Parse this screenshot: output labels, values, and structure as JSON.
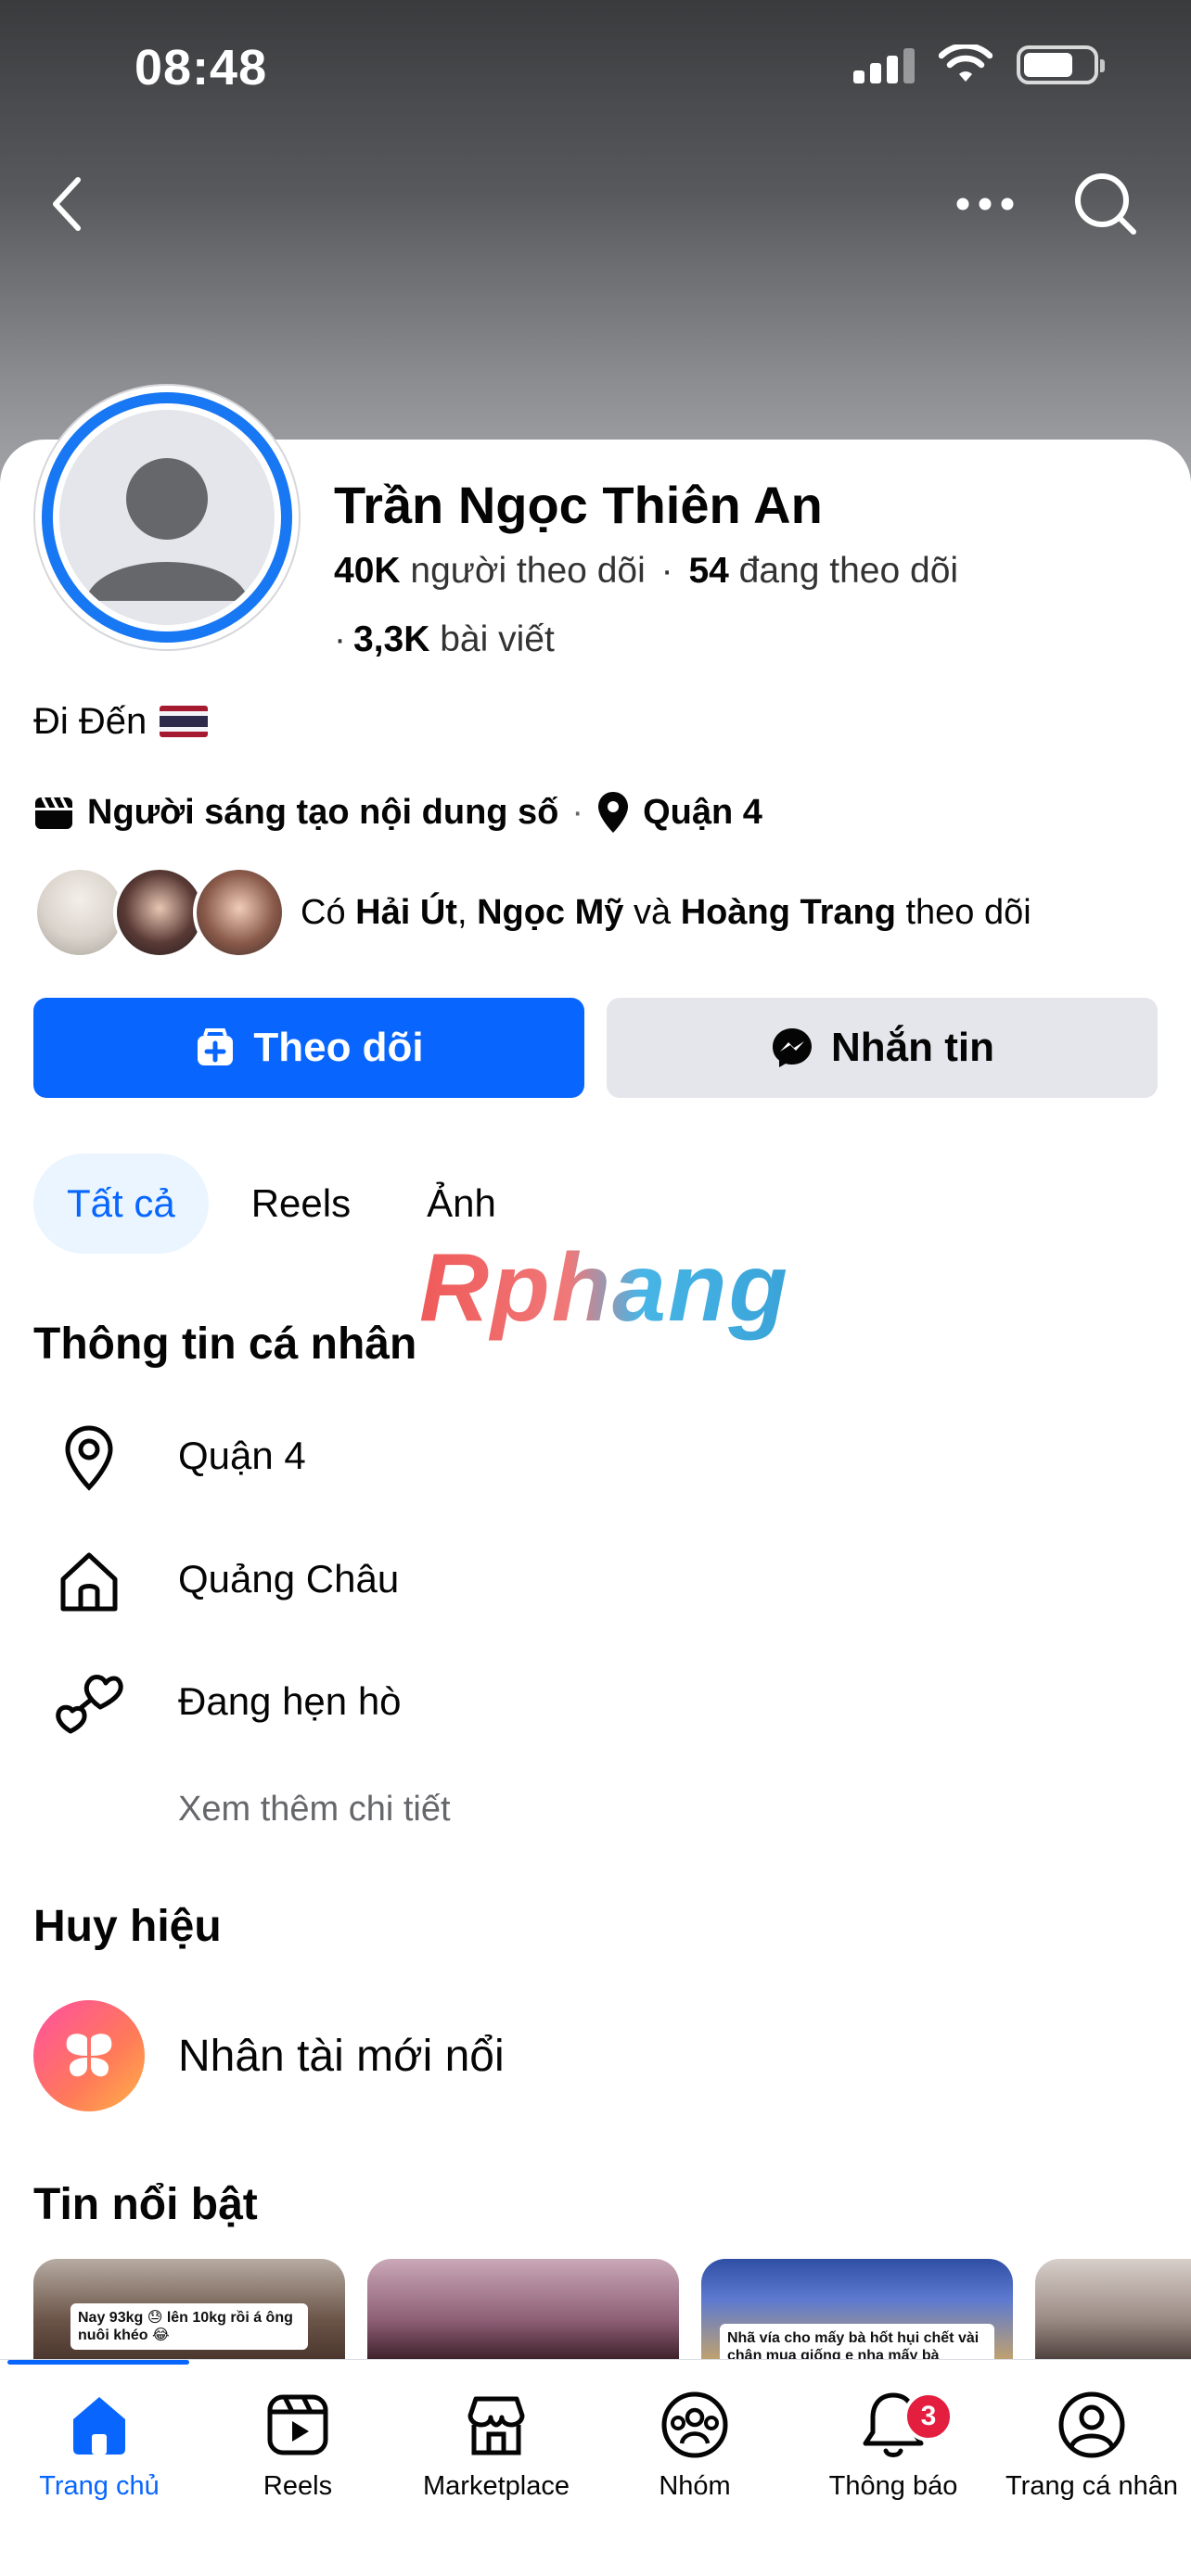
{
  "status_bar": {
    "time": "08:48"
  },
  "profile": {
    "name": "Trần Ngọc Thiên An",
    "followers_count": "40K",
    "followers_label": "người theo dõi",
    "following_count": "54",
    "following_label": "đang theo dõi",
    "posts_count": "3,3K",
    "posts_label": "bài viết",
    "bio": "Đi Đến",
    "category": "Người sáng tạo nội dung số",
    "location": "Quận 4",
    "mutual": {
      "prefix": "Có",
      "friend1": "Hải Út",
      "friend2": "Ngọc Mỹ",
      "connector": "và",
      "friend3": "Hoàng Trang",
      "suffix": "theo dõi"
    }
  },
  "actions": {
    "follow_label": "Theo dõi",
    "message_label": "Nhắn tin"
  },
  "tabs": [
    {
      "label": "Tất cả",
      "active": true
    },
    {
      "label": "Reels",
      "active": false
    },
    {
      "label": "Ảnh",
      "active": false
    }
  ],
  "watermark": "Rphang",
  "about": {
    "title": "Thông tin cá nhân",
    "items": [
      {
        "icon": "location-pin-icon",
        "label": "Quận 4"
      },
      {
        "icon": "home-icon",
        "label": "Quảng Châu"
      },
      {
        "icon": "hearts-icon",
        "label": "Đang hẹn hò"
      }
    ],
    "see_more": "Xem thêm chi tiết"
  },
  "badges": {
    "title": "Huy hiệu",
    "item_label": "Nhân tài mới nổi"
  },
  "highlights": {
    "title": "Tin nổi bật",
    "captions": [
      "Nay 93kg 😓 lên 10kg rồi á ông nuôi khéo 😂",
      "",
      "Nhã vía cho mấy bà hốt hụi chết vài chân mua giống e nha mấy bà",
      ""
    ]
  },
  "bottom_nav": [
    {
      "label": "Trang chủ",
      "icon": "home-filled-icon",
      "active": true
    },
    {
      "label": "Reels",
      "icon": "reels-icon",
      "active": false
    },
    {
      "label": "Marketplace",
      "icon": "marketplace-icon",
      "active": false
    },
    {
      "label": "Nhóm",
      "icon": "groups-icon",
      "active": false
    },
    {
      "label": "Thông báo",
      "icon": "bell-icon",
      "active": false,
      "badge": "3"
    },
    {
      "label": "Trang cá nhân",
      "icon": "profile-icon",
      "active": false
    }
  ],
  "colors": {
    "accent": "#0866ff",
    "badge_red": "#e41e3f"
  }
}
